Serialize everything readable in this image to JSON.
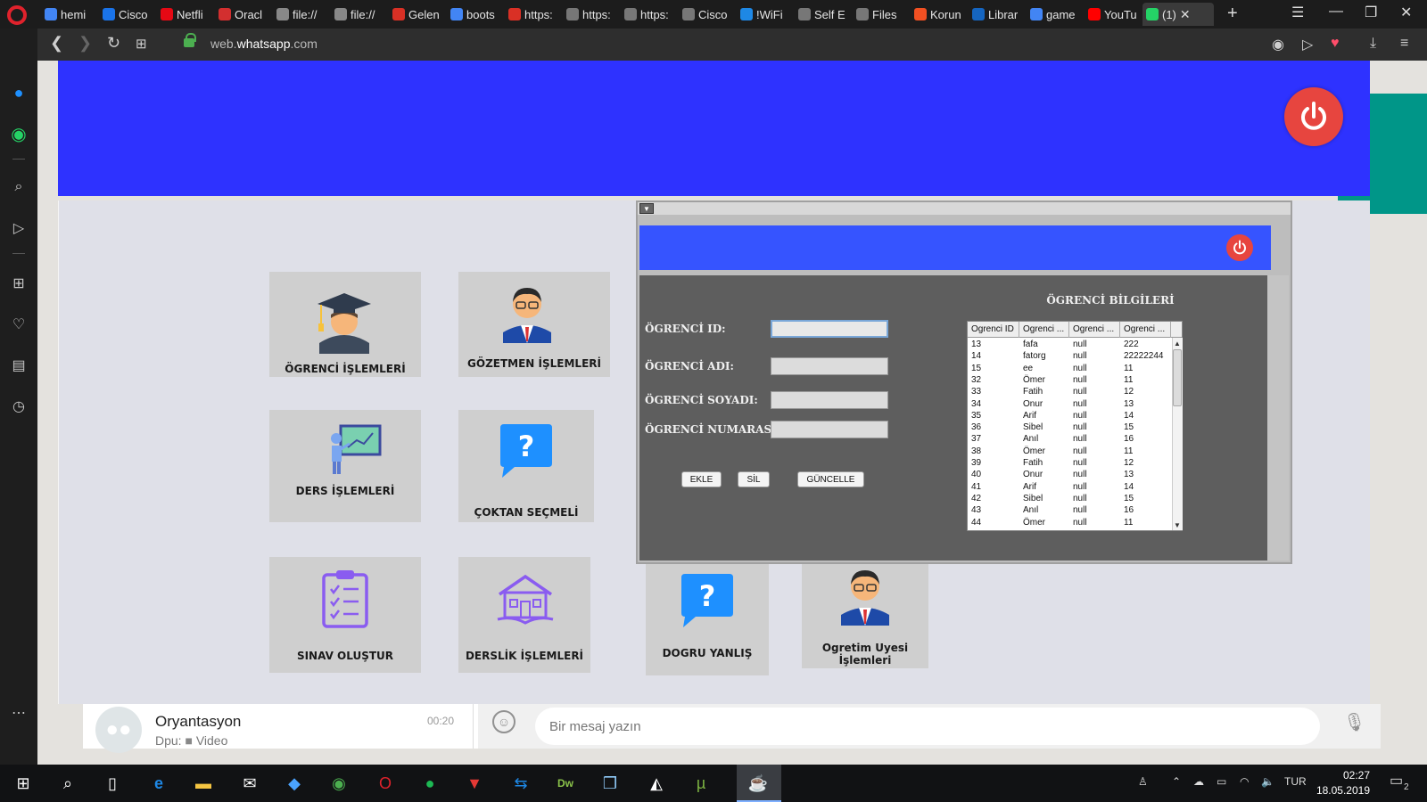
{
  "browser": {
    "tabs": [
      {
        "label": "hemi",
        "icon": "google-icon",
        "color": "#4285f4"
      },
      {
        "label": "Cisco",
        "icon": "cisco-icon",
        "color": "#1a73e8"
      },
      {
        "label": "Netfli",
        "icon": "netflix-icon",
        "color": "#e50914"
      },
      {
        "label": "Oracl",
        "icon": "oracle-icon",
        "color": "#d32f2f"
      },
      {
        "label": "file://",
        "icon": "file-icon",
        "color": "#888888"
      },
      {
        "label": "file://",
        "icon": "file-icon",
        "color": "#888888"
      },
      {
        "label": "Gelen",
        "icon": "gmail-icon",
        "color": "#d93025"
      },
      {
        "label": "boots",
        "icon": "google-icon",
        "color": "#4285f4"
      },
      {
        "label": "https:",
        "icon": "gmail-icon",
        "color": "#d93025"
      },
      {
        "label": "https:",
        "icon": "grid-icon",
        "color": "#777777"
      },
      {
        "label": "https:",
        "icon": "grid-icon",
        "color": "#777777"
      },
      {
        "label": "Cisco",
        "icon": "grid-icon",
        "color": "#777777"
      },
      {
        "label": "!WiFi",
        "icon": "wifi-icon",
        "color": "#1e88e5"
      },
      {
        "label": "Self E",
        "icon": "grid-icon",
        "color": "#777777"
      },
      {
        "label": "Files",
        "icon": "grid-icon",
        "color": "#777777"
      },
      {
        "label": "Korun",
        "icon": "microsoft-icon",
        "color": "#f25022"
      },
      {
        "label": "Librar",
        "icon": "library-icon",
        "color": "#1565c0"
      },
      {
        "label": "game",
        "icon": "google-icon",
        "color": "#4285f4"
      },
      {
        "label": "YouTu",
        "icon": "youtube-icon",
        "color": "#ff0000"
      },
      {
        "label": "(1)",
        "icon": "whatsapp-icon",
        "color": "#25d366"
      }
    ],
    "url_prefix": "web.",
    "url_domain": "whatsapp",
    "url_suffix": ".com"
  },
  "whatsapp": {
    "chat_name": "Oryantasyon",
    "chat_time": "00:20",
    "chat_sub_prefix": "Dpu:",
    "chat_sub": "Video",
    "message_placeholder": "Bir mesaj yazın"
  },
  "app": {
    "tiles": [
      {
        "label": "ÖGRENCİ İŞLEMLERİ"
      },
      {
        "label": "GÖZETMEN İŞLEMLERİ"
      },
      {
        "label": "DERS İŞLEMLERİ"
      },
      {
        "label": "ÇOKTAN SEÇMELİ"
      },
      {
        "label": "SINAV OLUŞTUR"
      },
      {
        "label": "DERSLİK İŞLEMLERİ"
      },
      {
        "label": "DOGRU YANLIŞ"
      },
      {
        "label": "Ogretim Uyesi İşlemleri"
      }
    ],
    "accent": "#2e32ff",
    "power_color": "#e7453f"
  },
  "form": {
    "labels": {
      "id": "ÖGRENCİ ID:",
      "name": "ÖGRENCİ ADI:",
      "surname": "ÖGRENCİ SOYADI:",
      "number": "ÖGRENCİ NUMARASI:"
    },
    "values": {
      "id": "",
      "name": "",
      "surname": "",
      "number": ""
    },
    "buttons": {
      "add": "EKLE",
      "delete": "SİL",
      "update": "GÜNCELLE"
    },
    "table_title": "ÖGRENCİ BİLGİLERİ"
  },
  "table": {
    "headers": [
      "Ogrenci ID",
      "Ogrenci ...",
      "Ogrenci ...",
      "Ogrenci ..."
    ],
    "rows": [
      [
        "13",
        "fafa",
        "null",
        "222"
      ],
      [
        "14",
        "fatorg",
        "null",
        "22222244"
      ],
      [
        "15",
        "ee",
        "null",
        "11"
      ],
      [
        "32",
        "Ömer",
        "null",
        "11"
      ],
      [
        "33",
        "Fatih",
        "null",
        "12"
      ],
      [
        "34",
        "Onur",
        "null",
        "13"
      ],
      [
        "35",
        "Arif",
        "null",
        "14"
      ],
      [
        "36",
        "Sibel",
        "null",
        "15"
      ],
      [
        "37",
        "Anıl",
        "null",
        "16"
      ],
      [
        "38",
        "Ömer",
        "null",
        "11"
      ],
      [
        "39",
        "Fatih",
        "null",
        "12"
      ],
      [
        "40",
        "Onur",
        "null",
        "13"
      ],
      [
        "41",
        "Arif",
        "null",
        "14"
      ],
      [
        "42",
        "Sibel",
        "null",
        "15"
      ],
      [
        "43",
        "Anıl",
        "null",
        "16"
      ],
      [
        "44",
        "Ömer",
        "null",
        "11"
      ]
    ]
  },
  "taskbar": {
    "language": "TUR",
    "time": "02:27",
    "date": "18.05.2019",
    "notifications": "2"
  }
}
